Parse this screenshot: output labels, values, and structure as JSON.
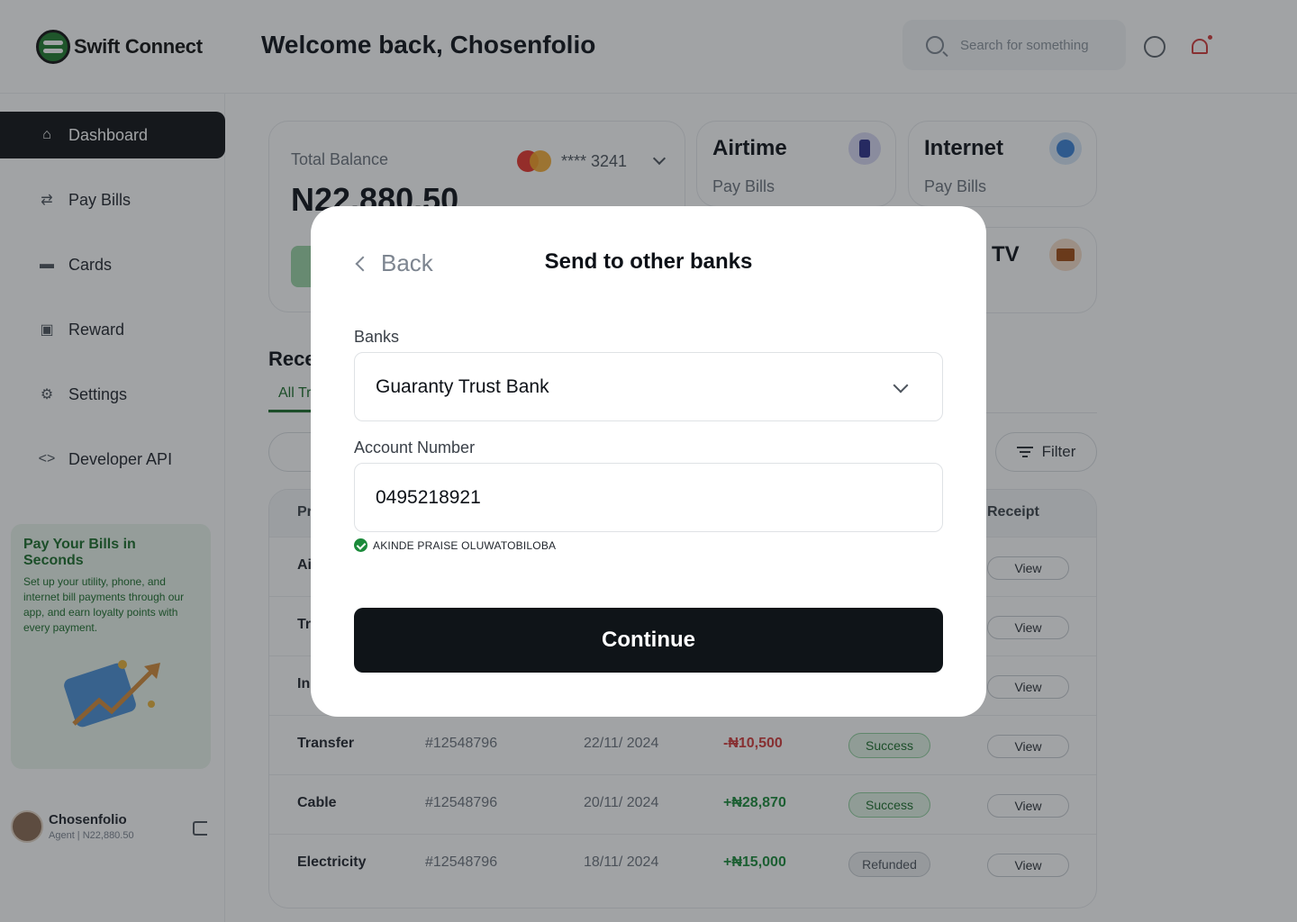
{
  "app": {
    "brand": "Swift Connect"
  },
  "header": {
    "welcome": "Welcome back, Chosenfolio",
    "search_placeholder": "Search for something"
  },
  "sidebar": {
    "items": [
      {
        "label": "Dashboard",
        "icon": "home-icon",
        "active": true
      },
      {
        "label": "Pay Bills",
        "icon": "transfer-icon"
      },
      {
        "label": "Cards",
        "icon": "card-icon"
      },
      {
        "label": "Reward",
        "icon": "gift-icon"
      },
      {
        "label": "Settings",
        "icon": "gear-icon"
      },
      {
        "label": "Developer API",
        "icon": "code-icon"
      }
    ],
    "promo": {
      "title": "Pay Your Bills in Seconds",
      "text": "Set up your utility, phone, and internet bill payments through our app, and earn loyalty points with every payment."
    },
    "profile": {
      "name": "Chosenfolio",
      "sub": "Agent | N22,880.50"
    }
  },
  "balance": {
    "label": "Total Balance",
    "value": "N22,880.50",
    "card_number": "**** 3241"
  },
  "services": {
    "airtime": {
      "title": "Airtime",
      "sub": "Pay Bills"
    },
    "internet": {
      "title": "Internet",
      "sub": "Pay Bills"
    },
    "tv": {
      "title": "TV"
    }
  },
  "recent": {
    "title": "Rece",
    "tab_all": "All Tr",
    "filter": "Filter"
  },
  "table": {
    "headers": {
      "product": "Pr",
      "receipt": "Receipt"
    },
    "partial_rows": [
      "Ai",
      "Tr",
      "In"
    ],
    "rows": [
      {
        "name": "Transfer",
        "id": "#12548796",
        "date": "22/11/ 2024",
        "amount": "-₦10,500",
        "status": "Success",
        "action": "View"
      },
      {
        "name": "Cable",
        "id": "#12548796",
        "date": "20/11/ 2024",
        "amount": "+₦28,870",
        "status": "Success",
        "action": "View"
      },
      {
        "name": "Electricity",
        "id": "#12548796",
        "date": "18/11/ 2024",
        "amount": "+₦15,000",
        "status": "Refunded",
        "action": "View"
      }
    ],
    "view_label": "View"
  },
  "modal": {
    "back": "Back",
    "title": "Send to other banks",
    "banks_label": "Banks",
    "bank_value": "Guaranty Trust Bank",
    "account_label": "Account Number",
    "account_value": "0495218921",
    "account_name": "AKINDE PRAISE OLUWATOBILOBA",
    "continue": "Continue"
  },
  "colors": {
    "primary_dark": "#0f1418",
    "brand_green": "#1b6d2a",
    "negative": "#d23a3a",
    "positive": "#1b8a3a"
  }
}
